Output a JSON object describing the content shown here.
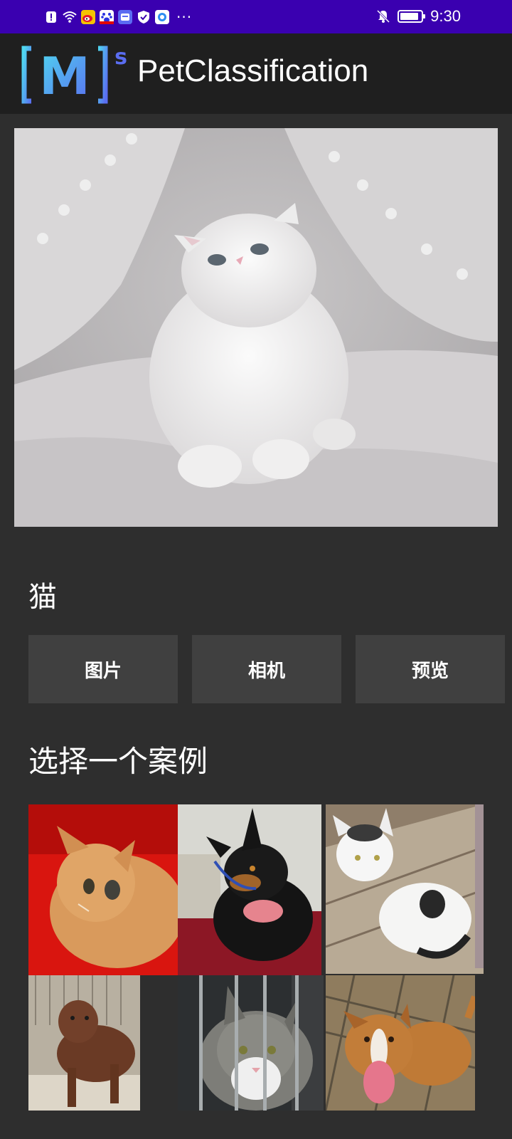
{
  "status_bar": {
    "time": "9:30",
    "battery_level": 0.9,
    "left_icons": [
      "notification-icon",
      "wifi-icon",
      "weibo-icon",
      "baidu-icon",
      "app-icon",
      "shield-icon",
      "browser-icon"
    ],
    "more_label": "···",
    "right_icons": [
      "bell-off-icon",
      "battery-icon"
    ]
  },
  "toolbar": {
    "logo_text": "M",
    "logo_superscript": "s",
    "title": "PetClassification"
  },
  "result": {
    "label": "猫"
  },
  "buttons": {
    "image": "图片",
    "camera": "相机",
    "preview": "预览"
  },
  "examples": {
    "title": "选择一个案例",
    "items": [
      {
        "subject": "orange-cat-on-red"
      },
      {
        "subject": "doberman-dog"
      },
      {
        "subject": "white-spotted-kitten"
      },
      {
        "subject": "brown-dog-in-kennel"
      },
      {
        "subject": "tabby-cat-behind-bars"
      },
      {
        "subject": "pitbull-dog-smiling"
      }
    ]
  },
  "colors": {
    "status_bar": "#3a00b0",
    "toolbar": "#1f1f1f",
    "background": "#2e2e2e",
    "button": "#404040",
    "logo_gradient_start": "#4fd8f0",
    "logo_gradient_end": "#5a6df0"
  }
}
